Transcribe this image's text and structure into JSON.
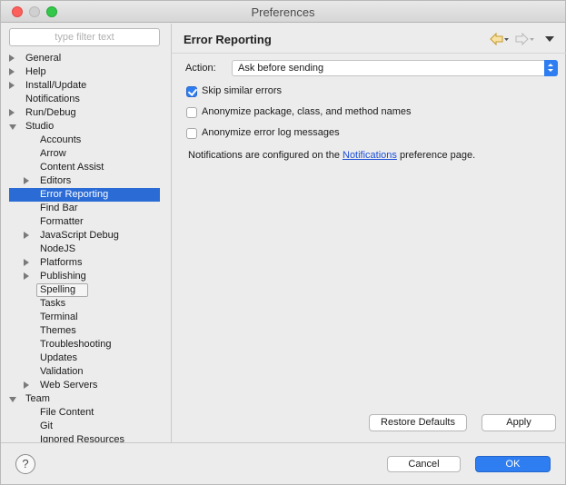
{
  "window": {
    "title": "Preferences"
  },
  "filter": {
    "placeholder": "type filter text"
  },
  "tree": {
    "items": [
      {
        "label": "General",
        "indent": 0,
        "expander": "collapsed"
      },
      {
        "label": "Help",
        "indent": 0,
        "expander": "collapsed"
      },
      {
        "label": "Install/Update",
        "indent": 0,
        "expander": "collapsed"
      },
      {
        "label": "Notifications",
        "indent": 0,
        "expander": "none"
      },
      {
        "label": "Run/Debug",
        "indent": 0,
        "expander": "collapsed"
      },
      {
        "label": "Studio",
        "indent": 0,
        "expander": "expanded"
      },
      {
        "label": "Accounts",
        "indent": 1,
        "expander": "none"
      },
      {
        "label": "Arrow",
        "indent": 1,
        "expander": "none"
      },
      {
        "label": "Content Assist",
        "indent": 1,
        "expander": "none"
      },
      {
        "label": "Editors",
        "indent": 1,
        "expander": "collapsed"
      },
      {
        "label": "Error Reporting",
        "indent": 1,
        "expander": "none",
        "selected": true
      },
      {
        "label": "Find Bar",
        "indent": 1,
        "expander": "none"
      },
      {
        "label": "Formatter",
        "indent": 1,
        "expander": "none"
      },
      {
        "label": "JavaScript Debug",
        "indent": 1,
        "expander": "collapsed"
      },
      {
        "label": "NodeJS",
        "indent": 1,
        "expander": "none"
      },
      {
        "label": "Platforms",
        "indent": 1,
        "expander": "collapsed"
      },
      {
        "label": "Publishing",
        "indent": 1,
        "expander": "collapsed"
      },
      {
        "label": "Spelling",
        "indent": 1,
        "expander": "none",
        "focused": true
      },
      {
        "label": "Tasks",
        "indent": 1,
        "expander": "none"
      },
      {
        "label": "Terminal",
        "indent": 1,
        "expander": "none"
      },
      {
        "label": "Themes",
        "indent": 1,
        "expander": "none"
      },
      {
        "label": "Troubleshooting",
        "indent": 1,
        "expander": "none"
      },
      {
        "label": "Updates",
        "indent": 1,
        "expander": "none"
      },
      {
        "label": "Validation",
        "indent": 1,
        "expander": "none"
      },
      {
        "label": "Web Servers",
        "indent": 1,
        "expander": "collapsed"
      },
      {
        "label": "Team",
        "indent": 0,
        "expander": "expanded"
      },
      {
        "label": "File Content",
        "indent": 1,
        "expander": "none"
      },
      {
        "label": "Git",
        "indent": 1,
        "expander": "none"
      },
      {
        "label": "Ignored Resources",
        "indent": 1,
        "expander": "none"
      }
    ]
  },
  "page": {
    "title": "Error Reporting",
    "action_label": "Action:",
    "action_value": "Ask before sending",
    "options": [
      {
        "label": "Skip similar errors",
        "checked": true
      },
      {
        "label": "Anonymize package, class, and method names",
        "checked": false
      },
      {
        "label": "Anonymize error log messages",
        "checked": false
      }
    ],
    "notif_before": "Notifications are configured on the ",
    "notif_link": "Notifications",
    "notif_after": " preference page.",
    "restore_defaults": "Restore Defaults",
    "apply": "Apply"
  },
  "footer": {
    "help_glyph": "?",
    "cancel": "Cancel",
    "ok": "OK"
  },
  "colors": {
    "selection": "#2a6bd6",
    "accent": "#2f7ef1",
    "link": "#1c4ed8"
  }
}
